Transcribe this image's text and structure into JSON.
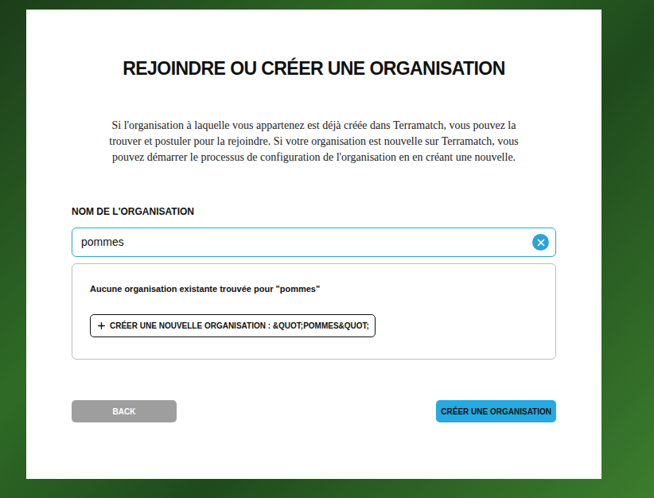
{
  "page": {
    "title": "REJOINDRE OU CRÉER UNE ORGANISATION",
    "description": "Si l'organisation à laquelle vous appartenez est déjà créée dans Terramatch, vous pouvez la trouver et postuler pour la rejoindre. Si votre organisation est nouvelle sur Terramatch, vous pouvez démarrer le processus de configuration de l'organisation en en créant une nouvelle."
  },
  "field": {
    "label": "NOM DE L'ORGANISATION",
    "value": "pommes"
  },
  "results": {
    "message": "Aucune organisation existante trouvée pour \"pommes\"",
    "create_new_button": "CRÉER UNE NOUVELLE ORGANISATION : &QUOT;POMMES&QUOT;"
  },
  "buttons": {
    "back": "BACK",
    "create": "CRÉER UNE ORGANISATION"
  }
}
